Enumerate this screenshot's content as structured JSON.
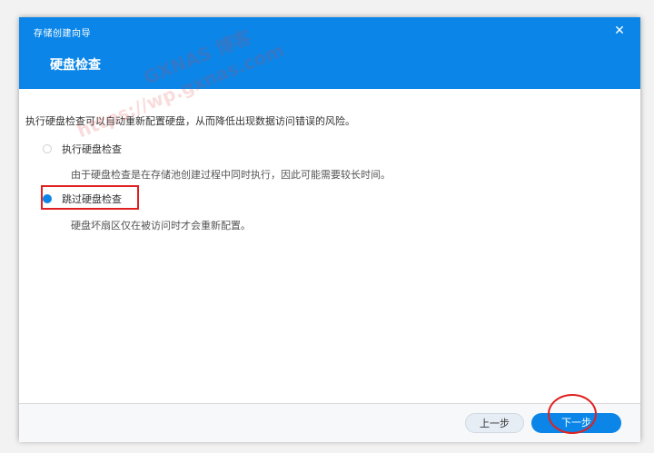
{
  "dialog": {
    "wizard_title": "存储创建向导",
    "page_title": "硬盘检查",
    "close_label": "✕",
    "description": "执行硬盘检查可以自动重新配置硬盘，从而降低出现数据访问错误的风险。",
    "options": [
      {
        "label": "执行硬盘检查",
        "description": "由于硬盘检查是在存储池创建过程中同时执行，因此可能需要较长时间。",
        "selected": false
      },
      {
        "label": "跳过硬盘检查",
        "description": "硬盘坏扇区仅在被访问时才会重新配置。",
        "selected": true
      }
    ]
  },
  "footer": {
    "prev_label": "上一步",
    "next_label": "下一步"
  },
  "watermark": {
    "line1": "GXNAS 博客",
    "line2": "https://wp.gxnas.com"
  },
  "colors": {
    "accent": "#0b86e8",
    "annotation": "#e02020"
  }
}
